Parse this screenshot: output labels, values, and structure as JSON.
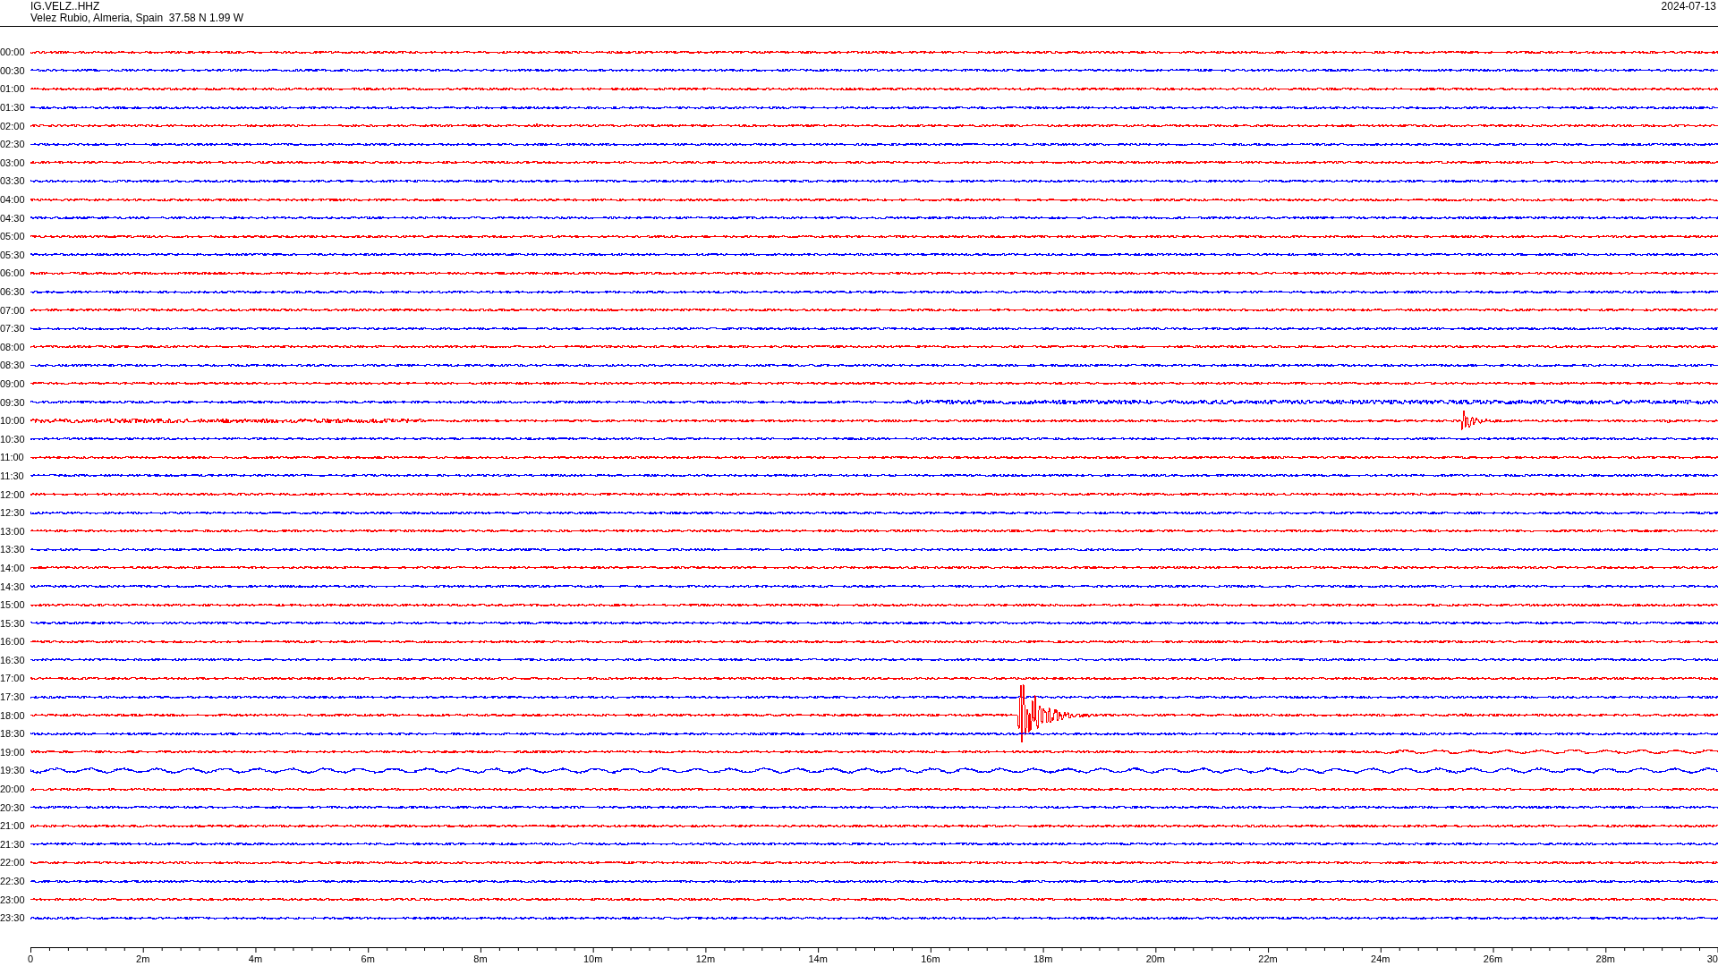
{
  "header": {
    "station": "IG.VELZ..HHZ",
    "location": "Velez Rubio, Almeria, Spain  37.58 N 1.99 W",
    "date": "2024-07-13"
  },
  "rows": [
    {
      "time": "00:00",
      "color": "#ff0000"
    },
    {
      "time": "00:30",
      "color": "#0000ff"
    },
    {
      "time": "01:00",
      "color": "#ff0000"
    },
    {
      "time": "01:30",
      "color": "#0000ff"
    },
    {
      "time": "02:00",
      "color": "#ff0000"
    },
    {
      "time": "02:30",
      "color": "#0000ff"
    },
    {
      "time": "03:00",
      "color": "#ff0000"
    },
    {
      "time": "03:30",
      "color": "#0000ff"
    },
    {
      "time": "04:00",
      "color": "#ff0000"
    },
    {
      "time": "04:30",
      "color": "#0000ff"
    },
    {
      "time": "05:00",
      "color": "#ff0000"
    },
    {
      "time": "05:30",
      "color": "#0000ff"
    },
    {
      "time": "06:00",
      "color": "#ff0000"
    },
    {
      "time": "06:30",
      "color": "#0000ff"
    },
    {
      "time": "07:00",
      "color": "#ff0000"
    },
    {
      "time": "07:30",
      "color": "#0000ff"
    },
    {
      "time": "08:00",
      "color": "#ff0000"
    },
    {
      "time": "08:30",
      "color": "#0000ff"
    },
    {
      "time": "09:00",
      "color": "#ff0000"
    },
    {
      "time": "09:30",
      "color": "#0000ff"
    },
    {
      "time": "10:00",
      "color": "#ff0000"
    },
    {
      "time": "10:30",
      "color": "#0000ff"
    },
    {
      "time": "11:00",
      "color": "#ff0000"
    },
    {
      "time": "11:30",
      "color": "#0000ff"
    },
    {
      "time": "12:00",
      "color": "#ff0000"
    },
    {
      "time": "12:30",
      "color": "#0000ff"
    },
    {
      "time": "13:00",
      "color": "#ff0000"
    },
    {
      "time": "13:30",
      "color": "#0000ff"
    },
    {
      "time": "14:00",
      "color": "#ff0000"
    },
    {
      "time": "14:30",
      "color": "#0000ff"
    },
    {
      "time": "15:00",
      "color": "#ff0000"
    },
    {
      "time": "15:30",
      "color": "#0000ff"
    },
    {
      "time": "16:00",
      "color": "#ff0000"
    },
    {
      "time": "16:30",
      "color": "#0000ff"
    },
    {
      "time": "17:00",
      "color": "#ff0000"
    },
    {
      "time": "17:30",
      "color": "#0000ff"
    },
    {
      "time": "18:00",
      "color": "#ff0000"
    },
    {
      "time": "18:30",
      "color": "#0000ff"
    },
    {
      "time": "19:00",
      "color": "#ff0000"
    },
    {
      "time": "19:30",
      "color": "#0000ff"
    },
    {
      "time": "20:00",
      "color": "#ff0000"
    },
    {
      "time": "20:30",
      "color": "#0000ff"
    },
    {
      "time": "21:00",
      "color": "#ff0000"
    },
    {
      "time": "21:30",
      "color": "#0000ff"
    },
    {
      "time": "22:00",
      "color": "#ff0000"
    },
    {
      "time": "22:30",
      "color": "#0000ff"
    },
    {
      "time": "23:00",
      "color": "#ff0000"
    },
    {
      "time": "23:30",
      "color": "#0000ff"
    }
  ],
  "x_axis": {
    "labels": [
      "0",
      "2m",
      "4m",
      "6m",
      "8m",
      "10m",
      "12m",
      "14m",
      "16m",
      "18m",
      "20m",
      "22m",
      "24m",
      "26m",
      "28m",
      "30"
    ]
  }
}
